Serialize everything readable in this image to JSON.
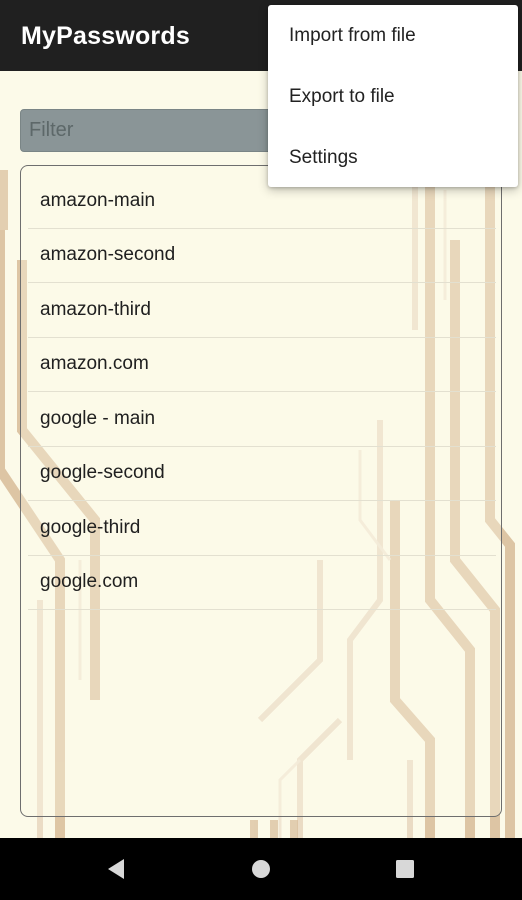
{
  "app_bar": {
    "title": "MyPasswords"
  },
  "filter": {
    "placeholder": "Filter",
    "value": ""
  },
  "entries": [
    "amazon-main",
    "amazon-second",
    "amazon-third",
    "amazon.com",
    "google - main",
    "google-second",
    "google-third",
    "google.com"
  ],
  "overflow_menu": {
    "items": [
      "Import from file",
      "Export to file",
      "Settings"
    ]
  },
  "nav_bar": {
    "buttons": [
      "back-icon",
      "home-icon",
      "recents-icon"
    ]
  },
  "colors": {
    "app_bar": "#202020",
    "background": "#fcfae9",
    "circuit_lines": "#d6b791",
    "filter_bg": "#8a9597",
    "nav_bar": "#000000"
  }
}
